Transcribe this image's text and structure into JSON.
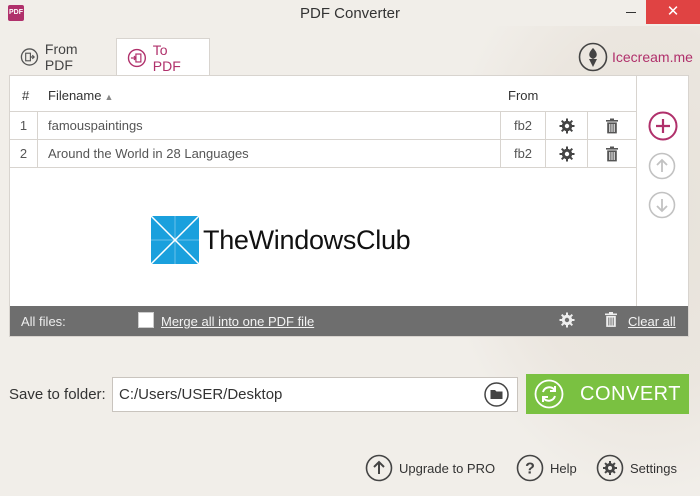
{
  "window": {
    "title": "PDF Converter",
    "close_glyph": "✕",
    "app_icon_text": "PDF"
  },
  "tabs": [
    {
      "label": "From PDF",
      "active": false
    },
    {
      "label": "To PDF",
      "active": true
    }
  ],
  "brand": {
    "label": "Icecream.me"
  },
  "table": {
    "headers": {
      "num": "#",
      "filename": "Filename",
      "sort_glyph": "▲",
      "from": "From"
    },
    "rows": [
      {
        "num": "1",
        "filename": "famouspaintings",
        "format": "fb2"
      },
      {
        "num": "2",
        "filename": "Around the World in 28 Languages",
        "format": "fb2"
      }
    ]
  },
  "watermark": {
    "text": "TheWindowsClub"
  },
  "all_files": {
    "label": "All files:",
    "merge_label": "Merge all into one PDF file",
    "merge_checked": false,
    "clear_label": "Clear all"
  },
  "save": {
    "label": "Save to folder:",
    "path": "C:/Users/USER/Desktop"
  },
  "convert": {
    "label": "CONVERT"
  },
  "footer": {
    "upgrade_label": "Upgrade to PRO",
    "help_label": "Help",
    "settings_label": "Settings"
  },
  "colors": {
    "accent": "#b0306b",
    "convert": "#7ac141",
    "close": "#e04343",
    "bar": "#6e6e6e"
  }
}
